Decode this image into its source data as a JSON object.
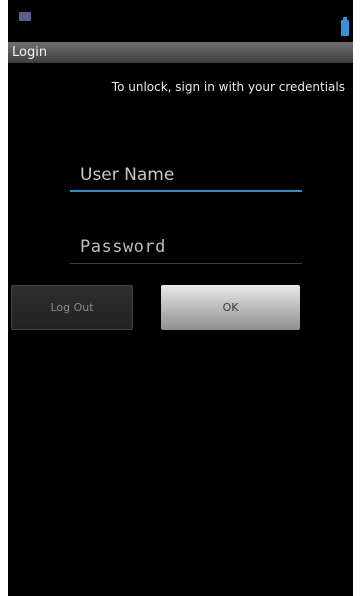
{
  "title_bar": {
    "title": "Login"
  },
  "instruction": "To unlock, sign in with your credentials",
  "form": {
    "username_placeholder": "User Name",
    "password_placeholder": "Password"
  },
  "buttons": {
    "logout_label": "Log Out",
    "ok_label": "OK"
  },
  "status_bar": {
    "icons": [
      "notification-icon",
      "battery-icon"
    ]
  },
  "colors": {
    "background": "#000000",
    "title_bar": "#555555",
    "focus_underline": "#2e8fc0",
    "ok_button": "#c0c0c0"
  }
}
